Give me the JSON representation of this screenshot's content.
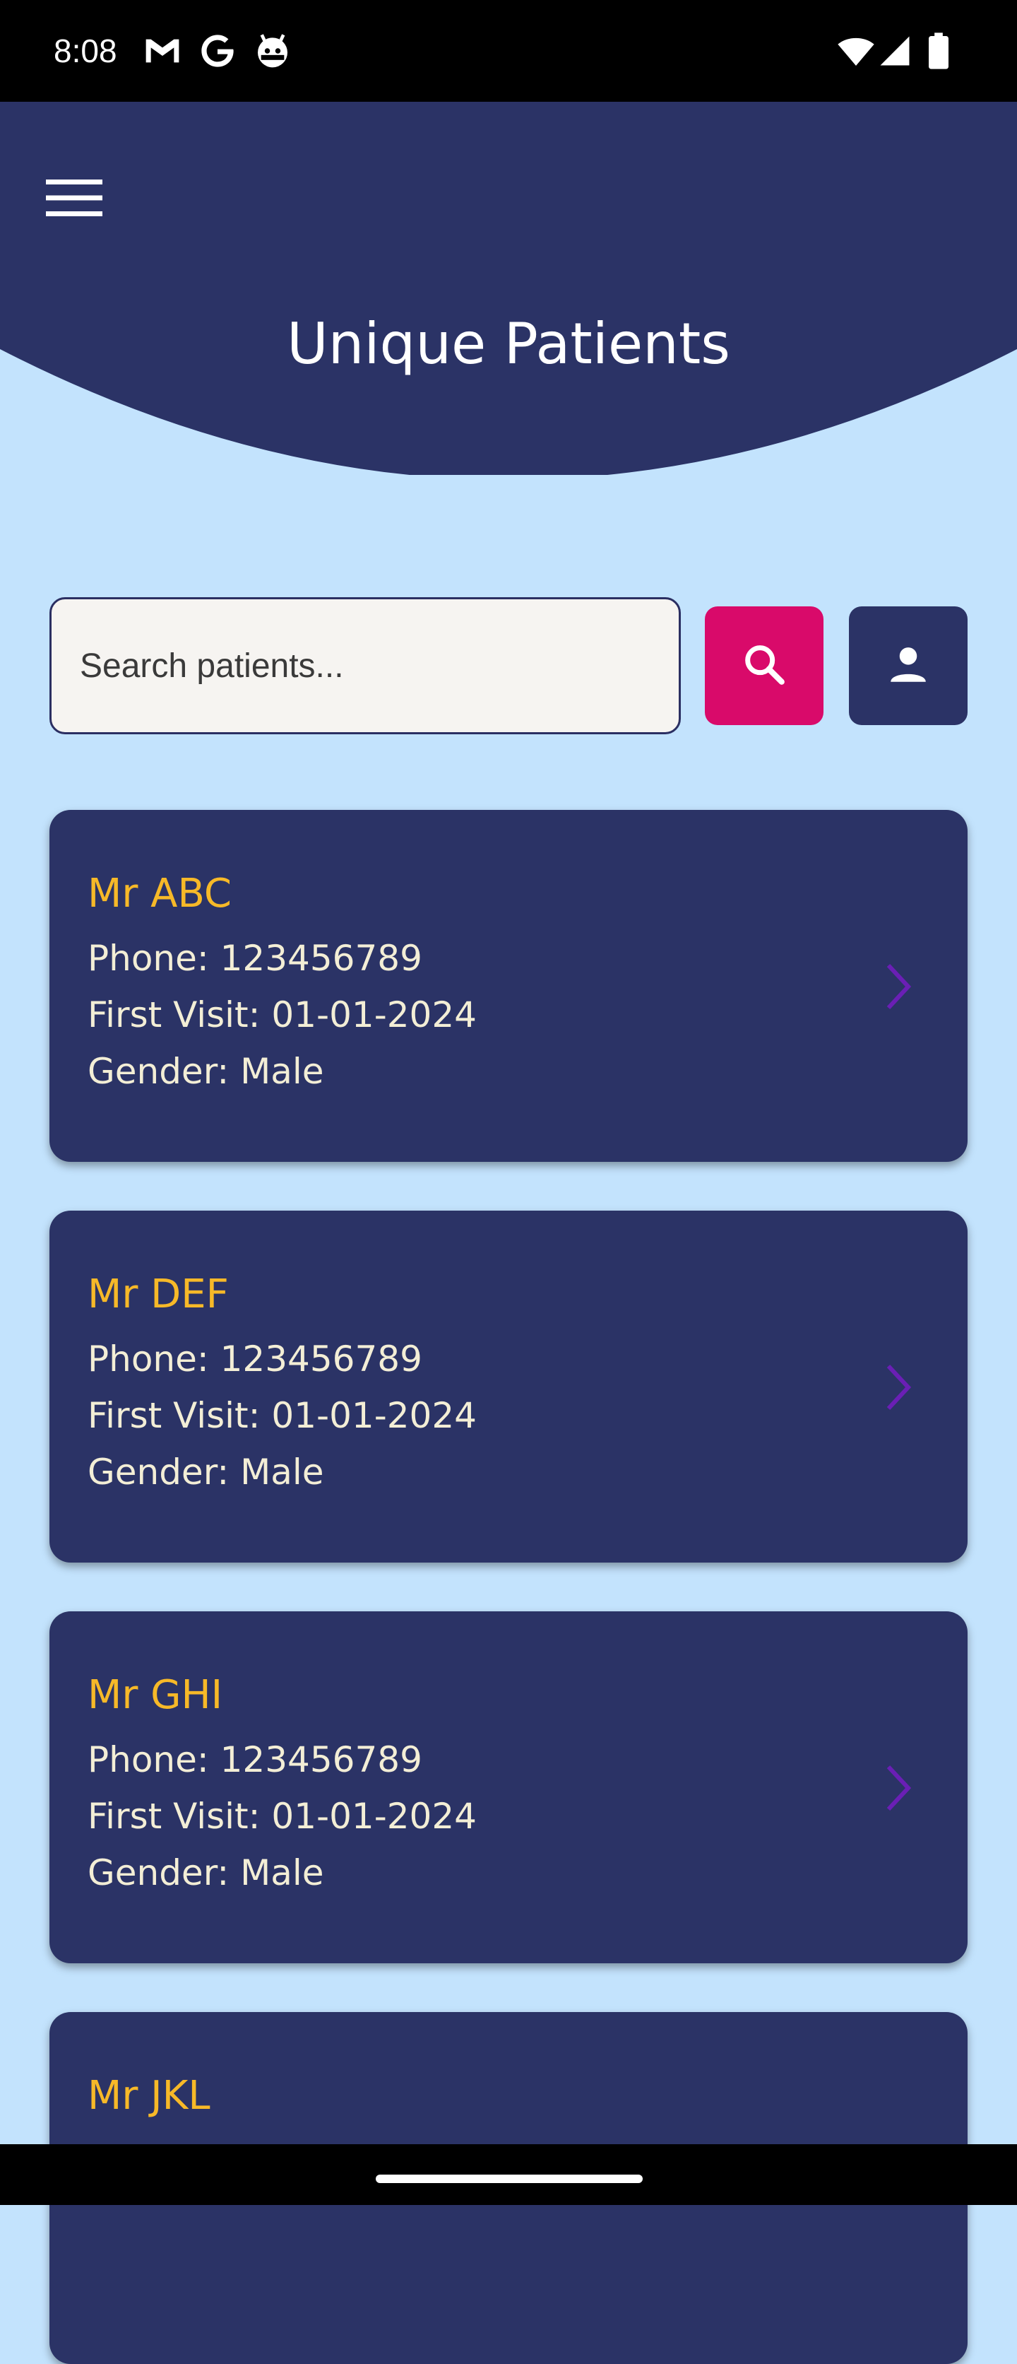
{
  "status_bar": {
    "time": "8:08",
    "left_icons": [
      "gmail-icon",
      "google-icon",
      "android-robot-icon"
    ],
    "right_icons": [
      "wifi-icon",
      "cell-signal-icon",
      "battery-icon"
    ]
  },
  "header": {
    "title": "Unique Patients",
    "menu_icon": "hamburger-menu-icon",
    "color": "#2b3366"
  },
  "search": {
    "placeholder": "Search patients...",
    "value": "",
    "search_button_icon": "search-icon",
    "profile_button_icon": "person-icon"
  },
  "patients": [
    {
      "name": "Mr ABC",
      "phone": "Phone: 123456789",
      "first_visit": "First Visit: 01-01-2024",
      "gender": "Gender: Male"
    },
    {
      "name": "Mr DEF",
      "phone": "Phone: 123456789",
      "first_visit": "First Visit: 01-01-2024",
      "gender": "Gender: Male"
    },
    {
      "name": "Mr GHI",
      "phone": "Phone: 123456789",
      "first_visit": "First Visit: 01-01-2024",
      "gender": "Gender: Male"
    },
    {
      "name": "Mr JKL",
      "phone": "",
      "first_visit": "",
      "gender": ""
    }
  ],
  "colors": {
    "background": "#c3e3fd",
    "card": "#2b3366",
    "name_text": "#f7b928",
    "detail_text": "#f3eed6",
    "search_button": "#d90a6a",
    "chevron": "#6a1fb5"
  }
}
